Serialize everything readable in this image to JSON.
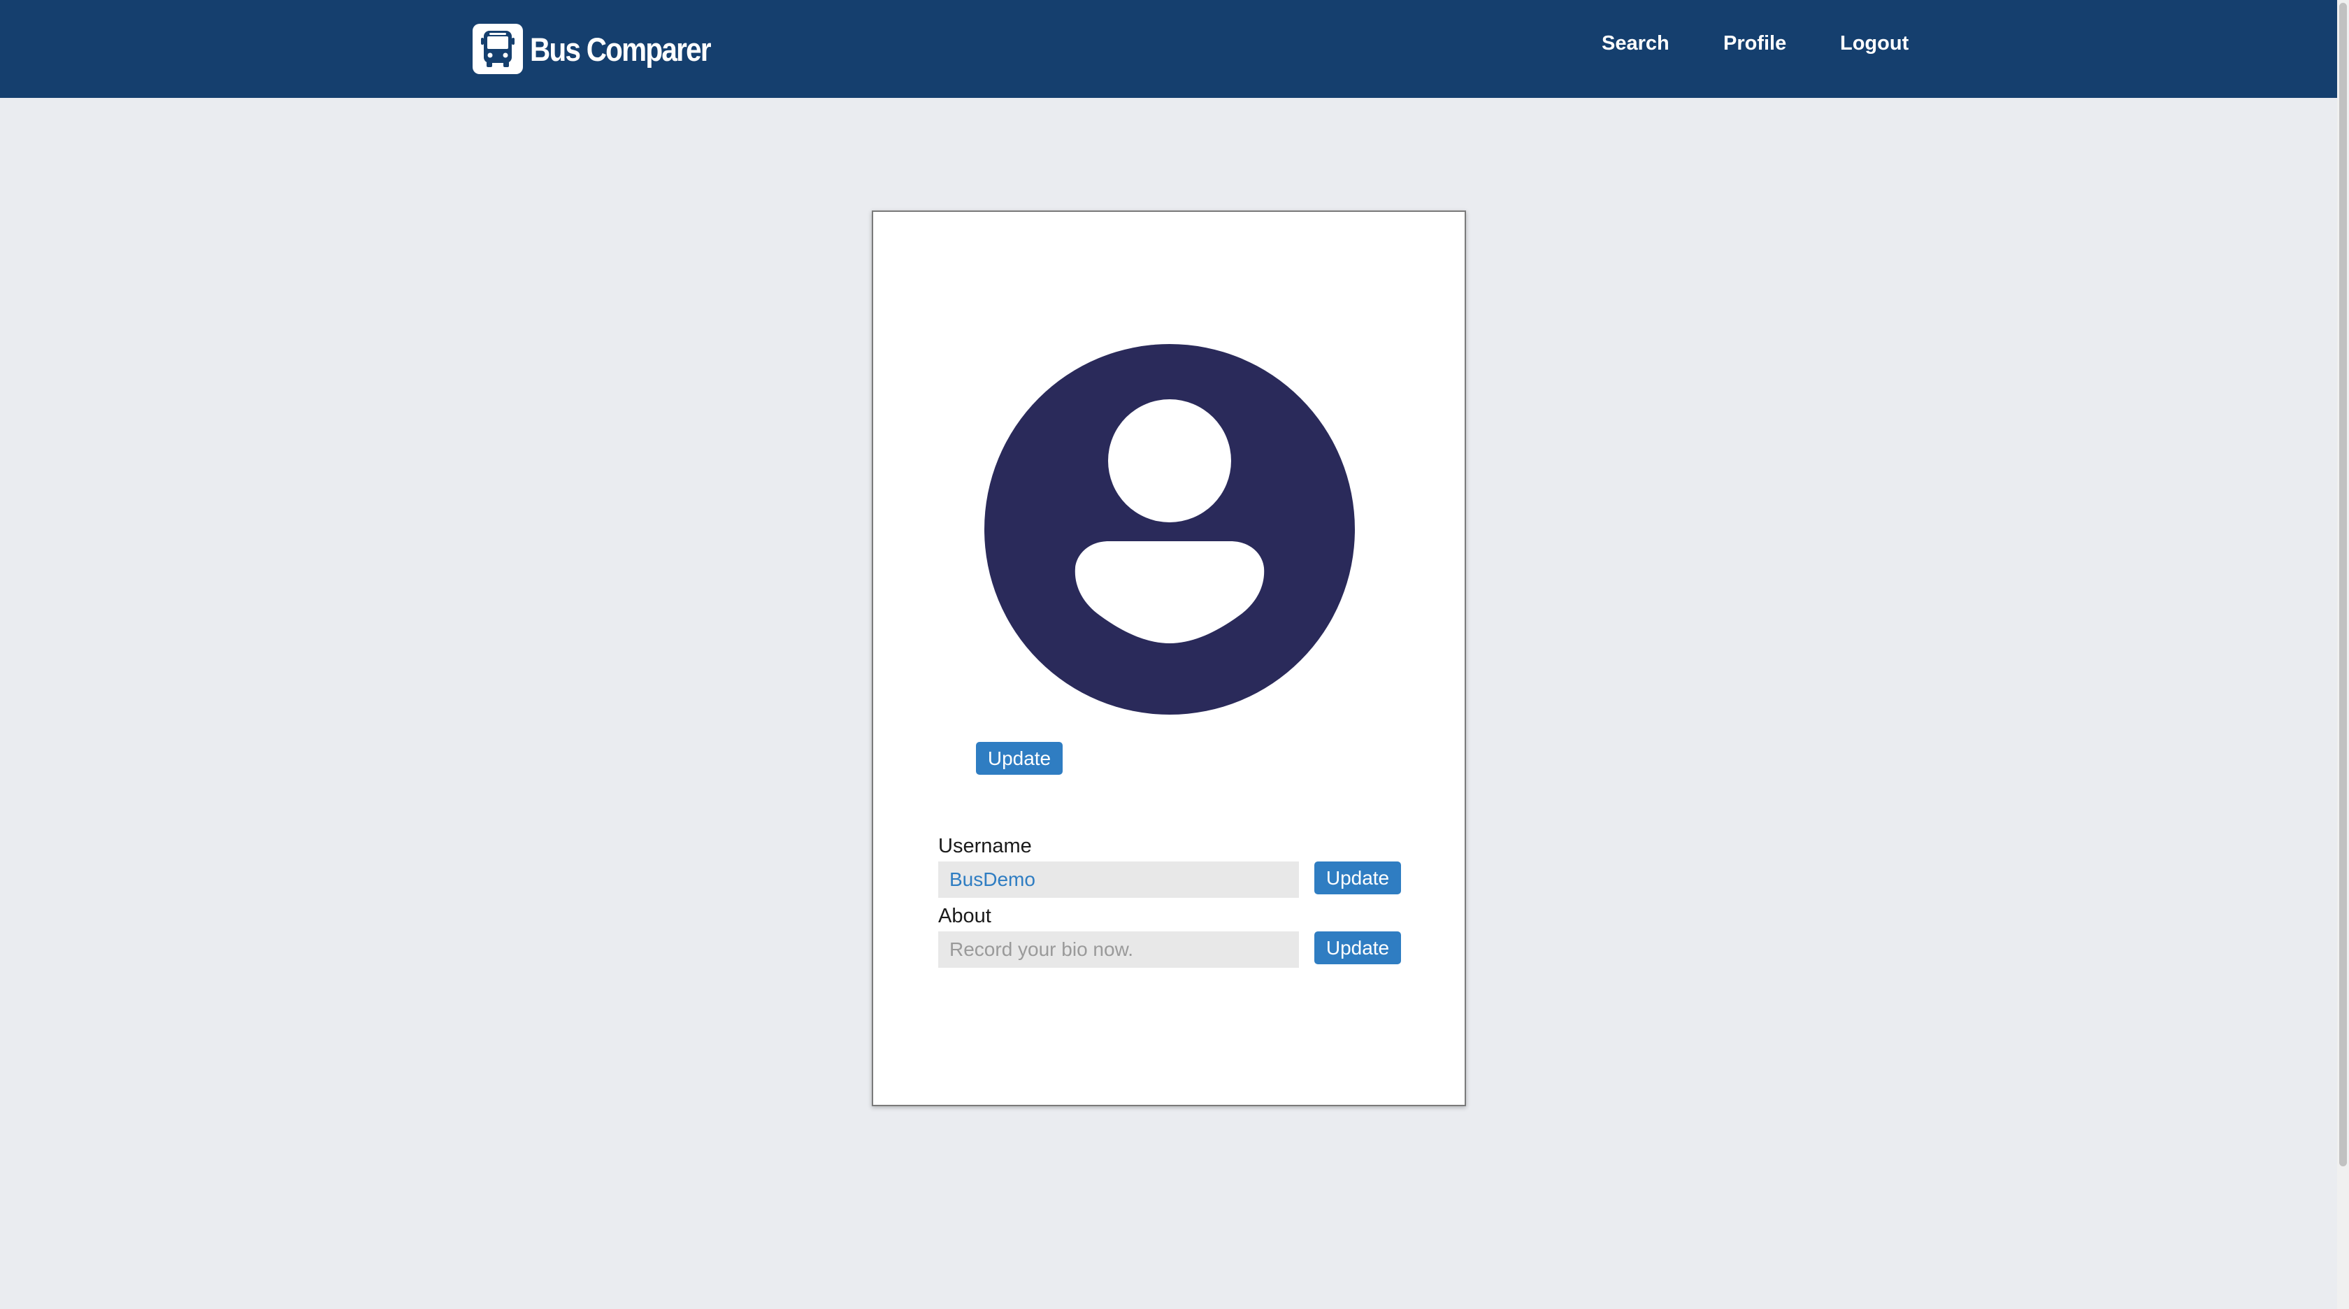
{
  "brand": {
    "name": "Bus Comparer",
    "icon": "bus-icon"
  },
  "nav": {
    "search": "Search",
    "profile": "Profile",
    "logout": "Logout"
  },
  "profile": {
    "avatar_icon": "user-avatar-icon",
    "avatar_update": "Update",
    "username_label": "Username",
    "username_value": "BusDemo",
    "username_update": "Update",
    "about_label": "About",
    "about_placeholder": "Record your bio now.",
    "about_update": "Update"
  },
  "colors": {
    "navbar": "#153f6e",
    "background": "#eaecf0",
    "avatar": "#2a2a5a",
    "button": "#2f7dc2"
  }
}
